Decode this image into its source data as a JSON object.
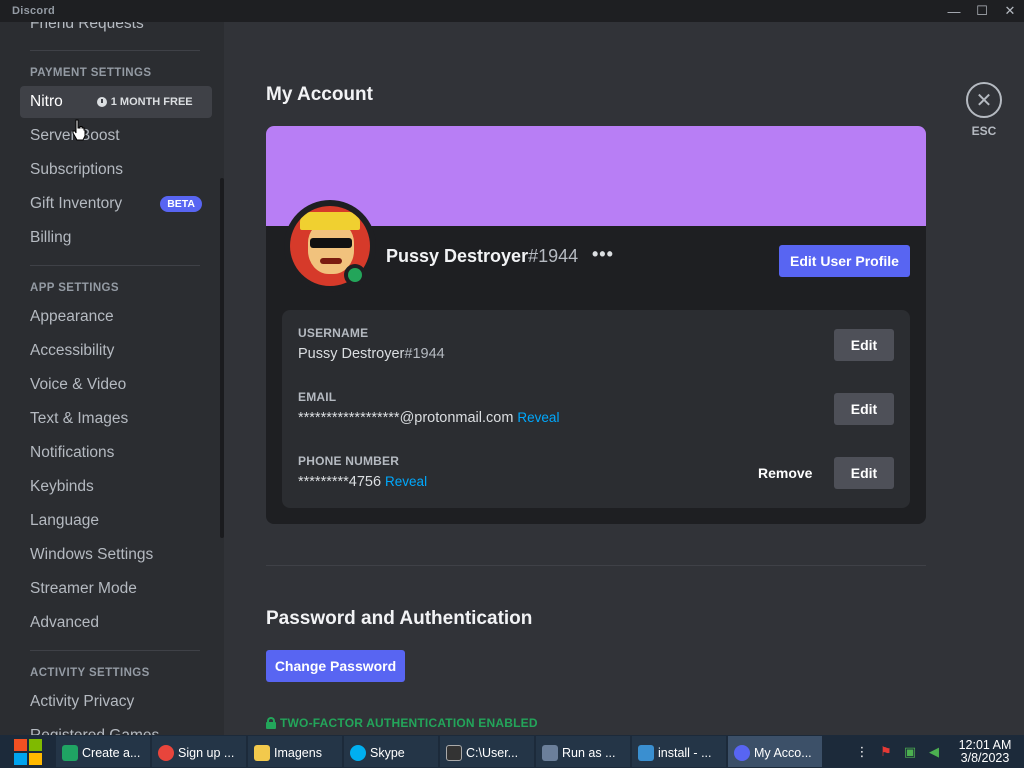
{
  "window": {
    "title": "Discord",
    "minimize_glyph": "—",
    "maximize_glyph": "☐",
    "close_glyph": "✕"
  },
  "sidebar": {
    "items": [
      {
        "label": "Friend Requests"
      },
      {
        "label": "Nitro"
      },
      {
        "label": "Server Boost"
      },
      {
        "label": "Subscriptions"
      },
      {
        "label": "Gift Inventory"
      },
      {
        "label": "Billing"
      },
      {
        "label": "Appearance"
      },
      {
        "label": "Accessibility"
      },
      {
        "label": "Voice & Video"
      },
      {
        "label": "Text & Images"
      },
      {
        "label": "Notifications"
      },
      {
        "label": "Keybinds"
      },
      {
        "label": "Language"
      },
      {
        "label": "Windows Settings"
      },
      {
        "label": "Streamer Mode"
      },
      {
        "label": "Advanced"
      },
      {
        "label": "Activity Privacy"
      },
      {
        "label": "Registered Games"
      }
    ],
    "headers": {
      "payment": "PAYMENT SETTINGS",
      "app": "APP SETTINGS",
      "activity": "ACTIVITY SETTINGS"
    },
    "nitro_badge": "1 MONTH FREE",
    "beta_badge": "BETA"
  },
  "main": {
    "title": "My Account",
    "close_label": "ESC",
    "close_glyph": "✕",
    "profile": {
      "name": "Pussy Destroyer",
      "discriminator": "#1944",
      "more_glyph": "•••",
      "edit_profile_label": "Edit User Profile",
      "status": "online",
      "banner_color": "#b87ef5"
    },
    "fields": {
      "username_label": "USERNAME",
      "username_name": "Pussy Destroyer",
      "username_disc": "#1944",
      "email_label": "EMAIL",
      "email_value": "******************@protonmail.com",
      "phone_label": "PHONE NUMBER",
      "phone_value": "*********4756",
      "reveal_label": "Reveal",
      "edit_label": "Edit",
      "remove_label": "Remove"
    },
    "password_section": {
      "title": "Password and Authentication",
      "change_password_label": "Change Password",
      "twofa_label": "TWO-FACTOR AUTHENTICATION ENABLED"
    }
  },
  "taskbar": {
    "items": [
      {
        "label": "Create a...",
        "icon": "document-icon",
        "color": "#1fa463"
      },
      {
        "label": "Sign up ...",
        "icon": "chrome-icon",
        "color": "#e8453c"
      },
      {
        "label": "Imagens",
        "icon": "folder-icon",
        "color": "#f2c94c"
      },
      {
        "label": "Skype",
        "icon": "skype-icon",
        "color": "#00aff0"
      },
      {
        "label": "C:\\User...",
        "icon": "terminal-icon",
        "color": "#333333"
      },
      {
        "label": "Run as ...",
        "icon": "run-icon",
        "color": "#6b7f9a"
      },
      {
        "label": "install - ...",
        "icon": "installer-icon",
        "color": "#3a8fd0"
      },
      {
        "label": "My Acco...",
        "icon": "discord-icon",
        "color": "#5865f2"
      }
    ],
    "time": "12:01 AM",
    "date": "3/8/2023"
  },
  "colors": {
    "accent": "#5865f2",
    "online": "#23a55a",
    "link": "#00a8fc"
  }
}
